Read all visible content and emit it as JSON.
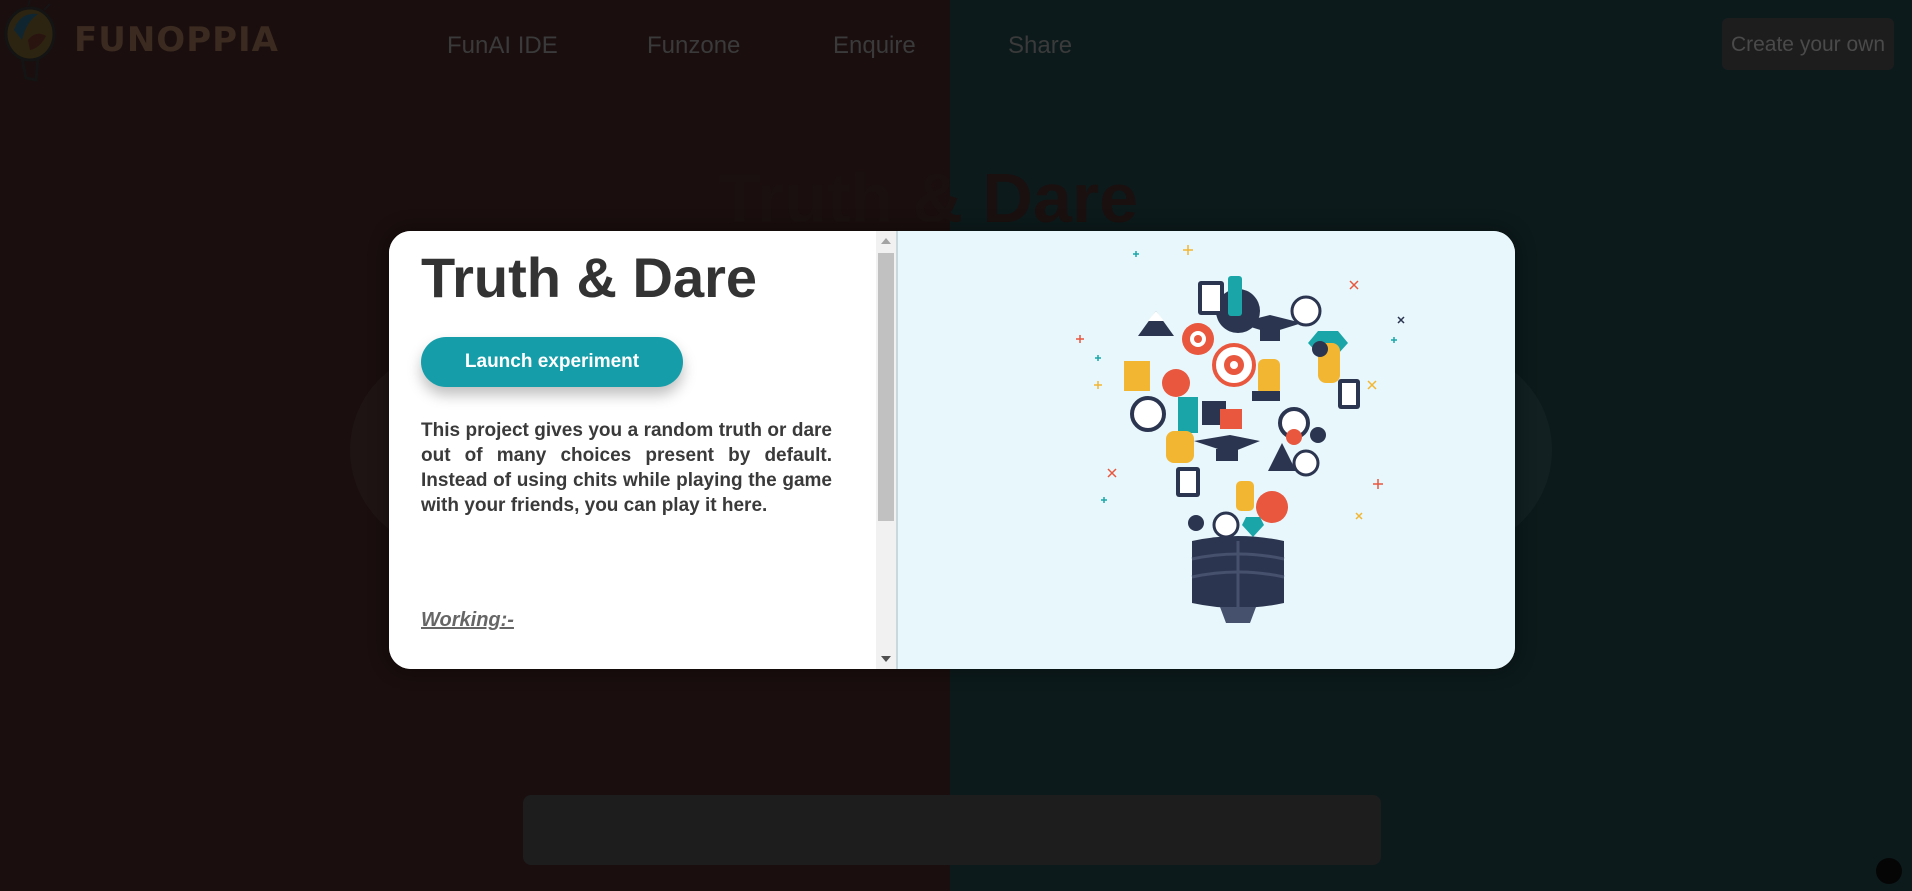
{
  "brand": {
    "name": "FUNOPPIA"
  },
  "nav": {
    "items": [
      {
        "label": "FunAI IDE"
      },
      {
        "label": "Funzone"
      },
      {
        "label": "Enquire"
      },
      {
        "label": "Share"
      }
    ],
    "create_label": "Create your own"
  },
  "background": {
    "title": "Truth & Dare"
  },
  "modal": {
    "title": "Truth & Dare",
    "launch_label": "Launch experiment",
    "description": "This project gives you a random truth or dare out of many choices present by default. Instead of using chits while playing the game with your friends, you can play it here.",
    "working_label": "Working:-"
  },
  "colors": {
    "accent": "#159ea9",
    "modal_right_bg": "#e8f7fc",
    "bg_left": "#1a0e0e",
    "bg_right": "#0c1a1b"
  },
  "icons": {
    "logo": "lightbulb-logo-icon",
    "illustration": "lightbulb-ideas-illustration"
  }
}
